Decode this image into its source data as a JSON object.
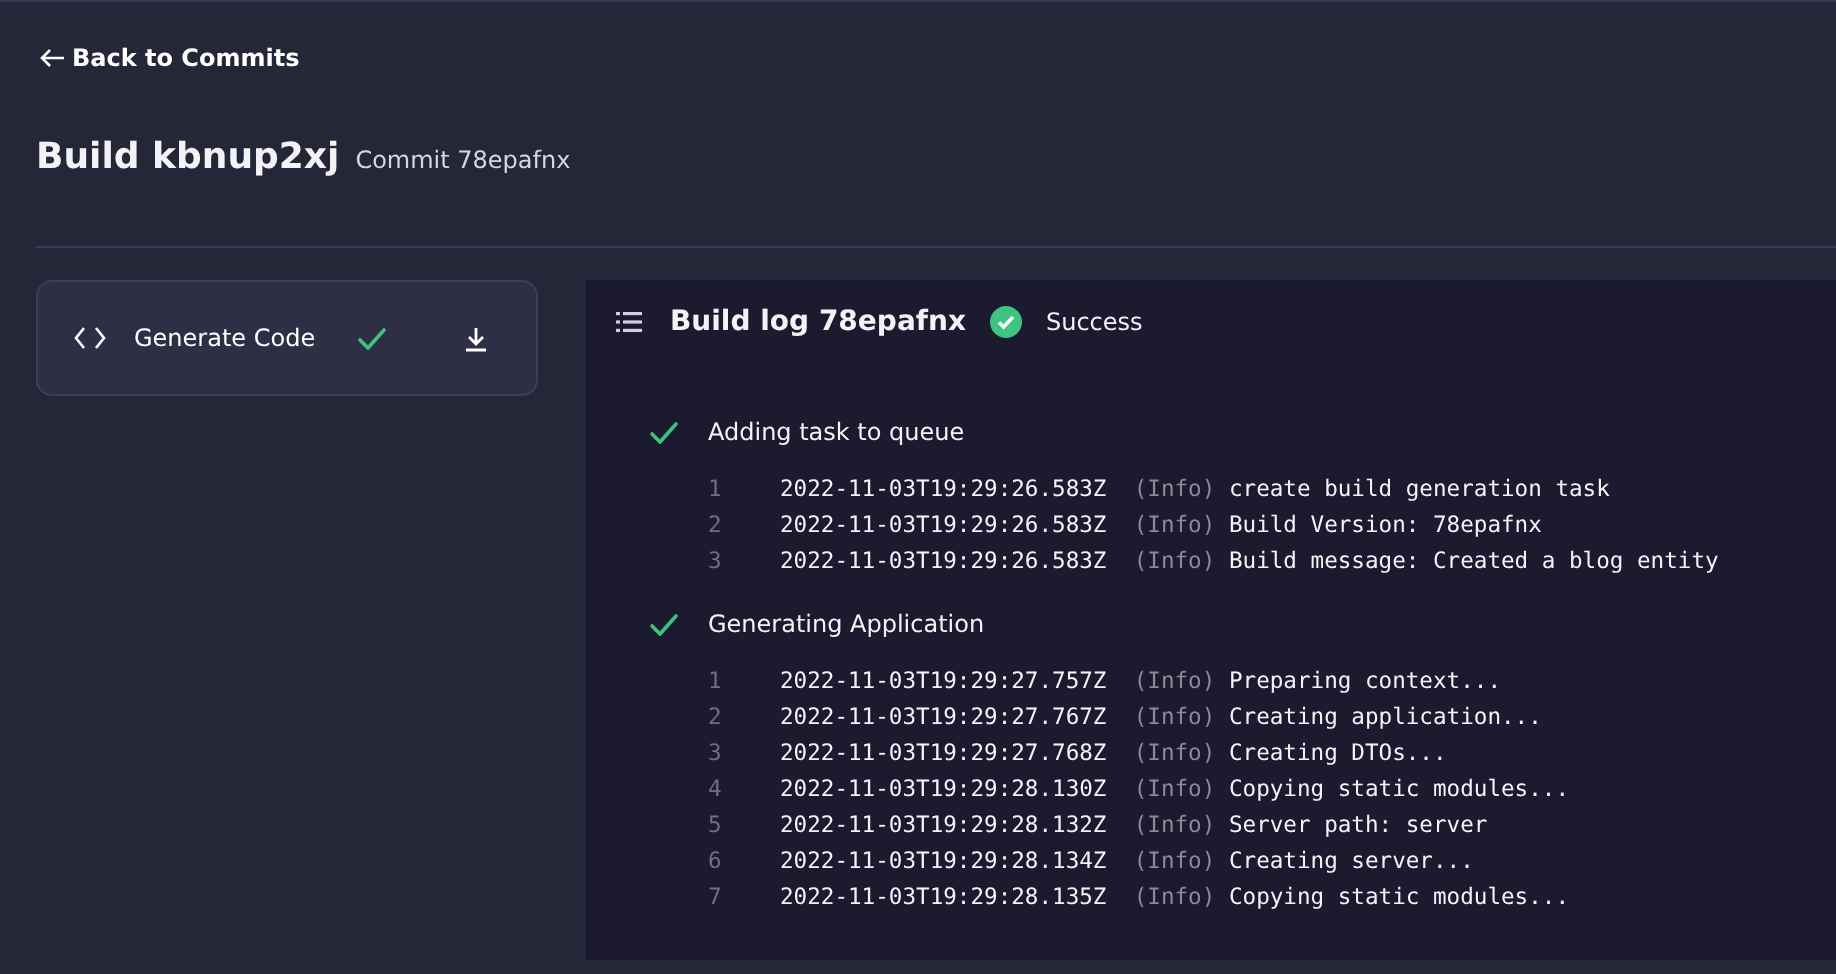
{
  "back_link": "Back to Commits",
  "header": {
    "title": "Build kbnup2xj",
    "subtitle": "Commit 78epafnx"
  },
  "sidebar": {
    "items": [
      {
        "label": "Generate Code",
        "done": true,
        "selected": true
      }
    ]
  },
  "log": {
    "title": "Build log 78epafnx",
    "status": {
      "kind": "success",
      "label": "Success"
    },
    "steps": [
      {
        "title": "Adding task to queue",
        "done": true,
        "lines": [
          {
            "number": "1",
            "timestamp": "2022-11-03T19:29:26.583Z",
            "level": "(Info)",
            "message": "create build generation task"
          },
          {
            "number": "2",
            "timestamp": "2022-11-03T19:29:26.583Z",
            "level": "(Info)",
            "message": "Build Version: 78epafnx"
          },
          {
            "number": "3",
            "timestamp": "2022-11-03T19:29:26.583Z",
            "level": "(Info)",
            "message": "Build message: Created a blog entity"
          }
        ]
      },
      {
        "title": "Generating Application",
        "done": true,
        "lines": [
          {
            "number": "1",
            "timestamp": "2022-11-03T19:29:27.757Z",
            "level": "(Info)",
            "message": "Preparing context..."
          },
          {
            "number": "2",
            "timestamp": "2022-11-03T19:29:27.767Z",
            "level": "(Info)",
            "message": "Creating application..."
          },
          {
            "number": "3",
            "timestamp": "2022-11-03T19:29:27.768Z",
            "level": "(Info)",
            "message": "Creating DTOs..."
          },
          {
            "number": "4",
            "timestamp": "2022-11-03T19:29:28.130Z",
            "level": "(Info)",
            "message": "Copying static modules..."
          },
          {
            "number": "5",
            "timestamp": "2022-11-03T19:29:28.132Z",
            "level": "(Info)",
            "message": "Server path: server"
          },
          {
            "number": "6",
            "timestamp": "2022-11-03T19:29:28.134Z",
            "level": "(Info)",
            "message": "Creating server..."
          },
          {
            "number": "7",
            "timestamp": "2022-11-03T19:29:28.135Z",
            "level": "(Info)",
            "message": "Copying static modules..."
          }
        ]
      }
    ]
  }
}
